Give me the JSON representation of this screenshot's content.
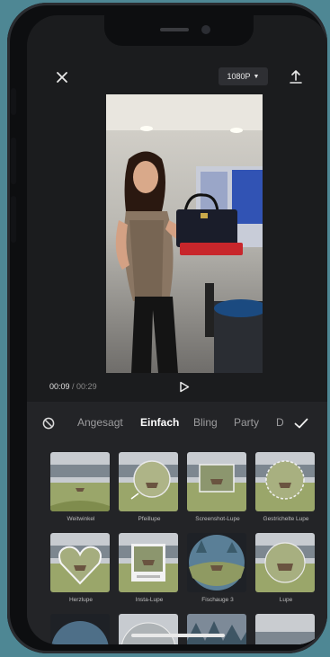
{
  "toolbar": {
    "close_icon": "close-icon",
    "resolution_label": "1080P",
    "export_icon": "upload-icon"
  },
  "player": {
    "current_time": "00:09",
    "separator": " / ",
    "duration": "00:29",
    "play_icon": "play-icon"
  },
  "effects": {
    "none_icon": "no-effect-icon",
    "tabs": [
      "Angesagt",
      "Einfach",
      "Bling",
      "Party",
      "D"
    ],
    "active_tab": "Einfach",
    "confirm_icon": "checkmark-icon",
    "items": [
      {
        "label": "Weitwinkel"
      },
      {
        "label": "Pfeillupe"
      },
      {
        "label": "Screenshot-Lupe"
      },
      {
        "label": "Gestrichelte Lupe"
      },
      {
        "label": "Herzlupe"
      },
      {
        "label": "Insta-Lupe"
      },
      {
        "label": "Fischauge 3"
      },
      {
        "label": "Lupe"
      },
      {
        "label": ""
      },
      {
        "label": ""
      },
      {
        "label": ""
      },
      {
        "label": ""
      }
    ]
  },
  "colors": {
    "background": "#4e8794",
    "panel": "#232427",
    "screen": "#1b1c1e"
  }
}
